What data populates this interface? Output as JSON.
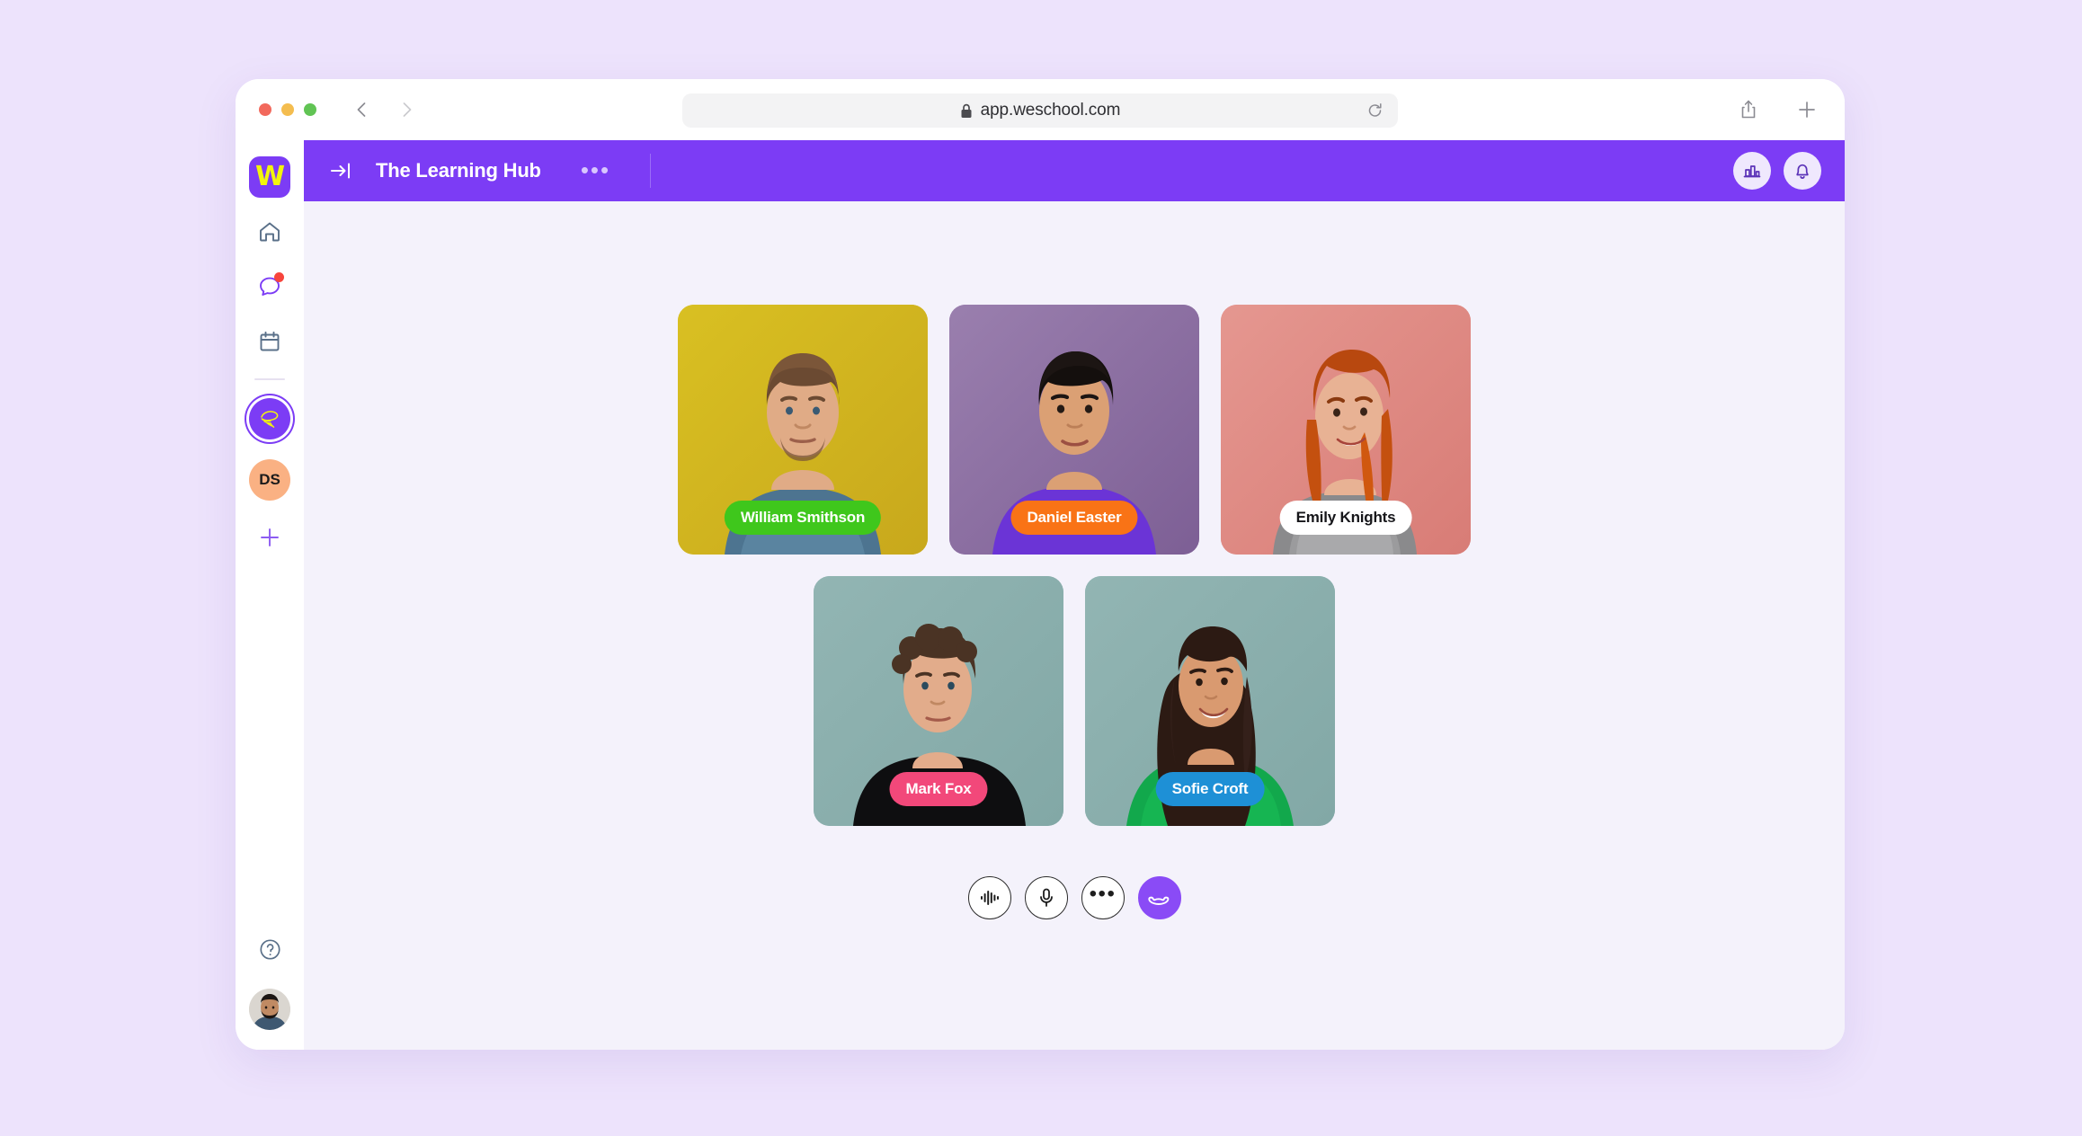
{
  "browser": {
    "url": "app.weschool.com",
    "icons": {
      "lock": "lock-icon",
      "reload": "reload-icon",
      "back": "back-arrow-icon",
      "forward": "forward-arrow-icon",
      "share": "share-icon",
      "new_tab": "plus-icon"
    }
  },
  "rail": {
    "logo_letter": "W",
    "items": [
      {
        "name": "home",
        "label": "Home"
      },
      {
        "name": "chat",
        "label": "Chat",
        "has_badge": true
      },
      {
        "name": "calendar",
        "label": "Calendar"
      }
    ],
    "groups": [
      {
        "name": "learning-hub",
        "label": "The Learning Hub",
        "active": true
      },
      {
        "name": "ds-group",
        "label": "DS",
        "initials": "DS"
      }
    ],
    "add_label": "+",
    "help_label": "?",
    "avatar_label": "User avatar"
  },
  "header": {
    "title": "The Learning Hub",
    "more_label": "•••",
    "collapse_label": "Collapse sidebar",
    "analytics_label": "Analytics",
    "notifications_label": "Notifications"
  },
  "call": {
    "participants": [
      {
        "name": "William Smithson",
        "chip_bg": "#3FC71C",
        "chip_fg": "#ffffff",
        "tile_bg": "#D6BB1F",
        "row": 1
      },
      {
        "name": "Daniel Easter",
        "chip_bg": "#F97316",
        "chip_fg": "#ffffff",
        "tile_bg": "#8C6EA5",
        "row": 1
      },
      {
        "name": "Emily Knights",
        "chip_bg": "#FFFFFF",
        "chip_fg": "#16161A",
        "tile_bg": "#E08A83",
        "row": 1
      },
      {
        "name": "Mark Fox",
        "chip_bg": "#F2487A",
        "chip_fg": "#ffffff",
        "tile_bg": "#8BB0AE",
        "row": 2
      },
      {
        "name": "Sofie Croft",
        "chip_bg": "#1E90D6",
        "chip_fg": "#ffffff",
        "tile_bg": "#8BB0AE",
        "row": 2
      }
    ],
    "controls": [
      {
        "name": "audio-waveform",
        "label": "Audio levels"
      },
      {
        "name": "microphone",
        "label": "Microphone"
      },
      {
        "name": "more-options",
        "label": "•••"
      },
      {
        "name": "hang-up",
        "label": "End call"
      }
    ]
  },
  "colors": {
    "brand_purple": "#7C3CF5",
    "brand_yellow": "#F2F50C",
    "page_bg": "#EDE3FC",
    "content_bg": "#F4F2FB",
    "badge_red": "#F7453C"
  }
}
